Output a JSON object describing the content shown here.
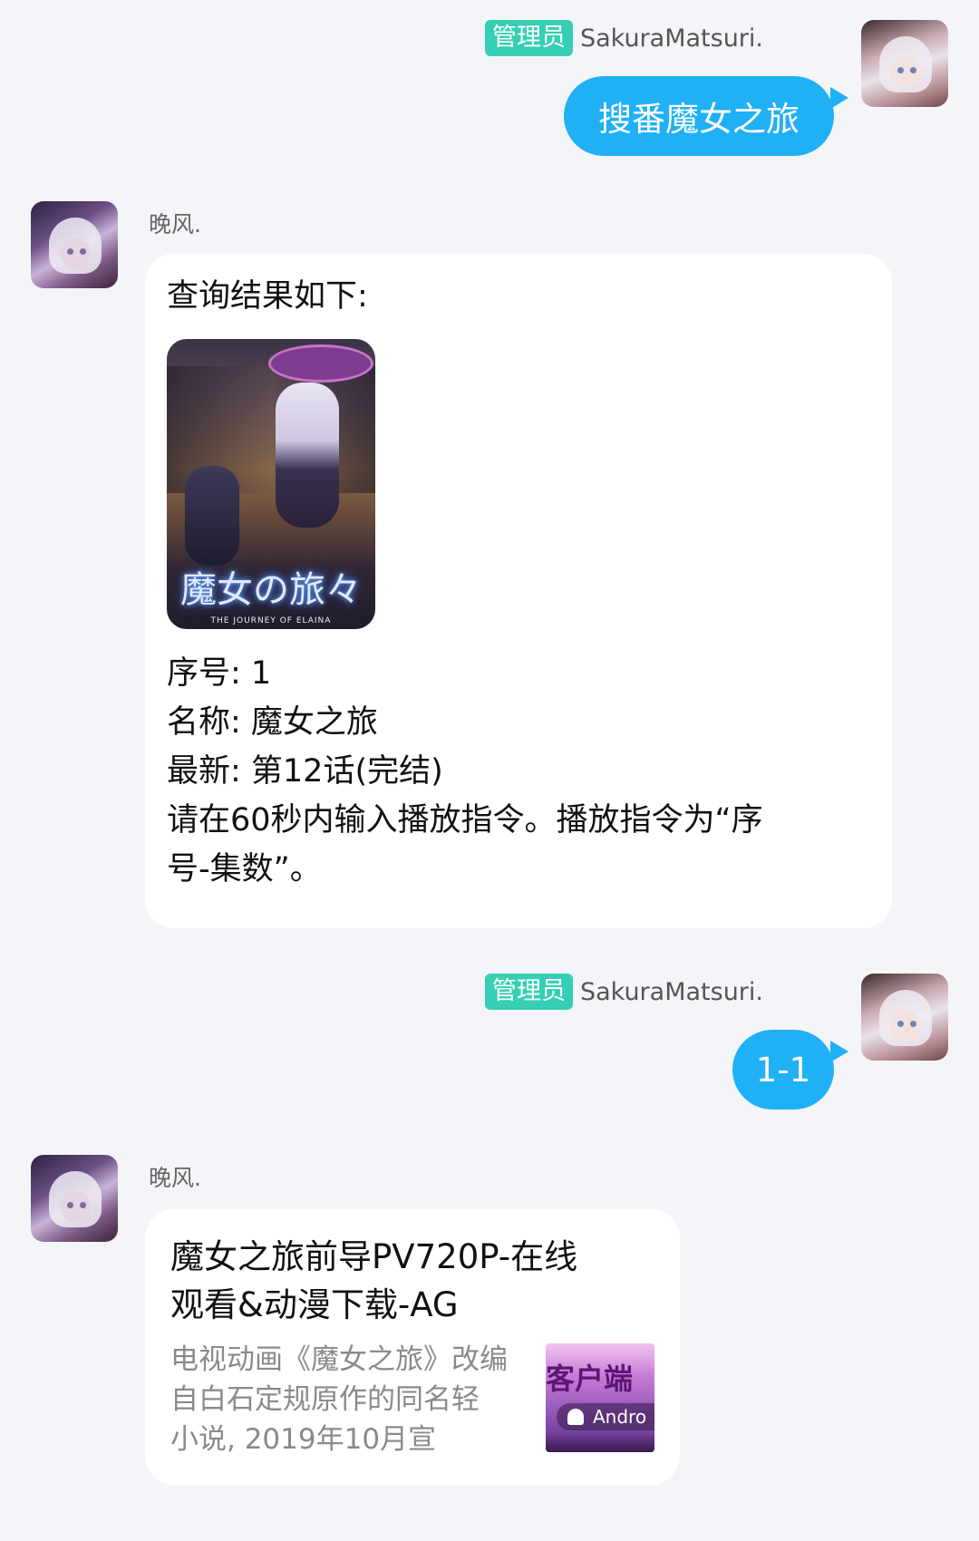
{
  "messages": [
    {
      "direction": "out",
      "sender_role": "管理员",
      "sender_name": "SakuraMatsuri.",
      "text": "搜番魔女之旅"
    },
    {
      "direction": "in",
      "sender_name": "晚风.",
      "header": "查询结果如下:",
      "poster": {
        "title": "魔女の旅々",
        "subtitle": "THE JOURNEY OF ELAINA"
      },
      "lines": [
        "序号: 1",
        "名称: 魔女之旅",
        "最新: 第12话(完结)",
        "请在60秒内输入播放指令。播放指令为“序",
        "号-集数”。"
      ]
    },
    {
      "direction": "out",
      "sender_role": "管理员",
      "sender_name": "SakuraMatsuri.",
      "text": "1-1"
    },
    {
      "direction": "in",
      "sender_name": "晚风.",
      "card": {
        "title_lines": [
          "魔女之旅前导PV720P-在线",
          "观看&动漫下载-AG"
        ],
        "desc_lines": [
          "电视动画《魔女之旅》改编",
          "自白石定规原作的同名轻",
          "小说, 2019年10月宣"
        ],
        "thumb_text": "客户端",
        "thumb_pill": "Andro"
      }
    }
  ],
  "colors": {
    "background": "#f4f5f9",
    "outgoing_bubble": "#20b0f6",
    "incoming_bubble": "#ffffff",
    "role_badge": "#36cfb3"
  }
}
